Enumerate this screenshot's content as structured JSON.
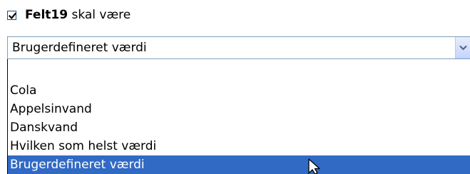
{
  "condition": {
    "checked": true,
    "field_name": "Felt19",
    "suffix": " skal være"
  },
  "select": {
    "value": "Brugerdefineret værdi",
    "options": [
      {
        "label": "",
        "selected": false
      },
      {
        "label": "Cola",
        "selected": false
      },
      {
        "label": "Appelsinvand",
        "selected": false
      },
      {
        "label": "Danskvand",
        "selected": false
      },
      {
        "label": "Hvilken som helst værdi",
        "selected": false
      },
      {
        "label": "Brugerdefineret værdi",
        "selected": true
      }
    ]
  },
  "colors": {
    "selection_background": "#316ac5",
    "selection_text": "#ffffff",
    "border": "#7f9db9"
  },
  "icons": {
    "checkbox": "checkmark-icon",
    "dropdown": "chevron-down-icon",
    "cursor": "mouse-pointer-icon"
  }
}
